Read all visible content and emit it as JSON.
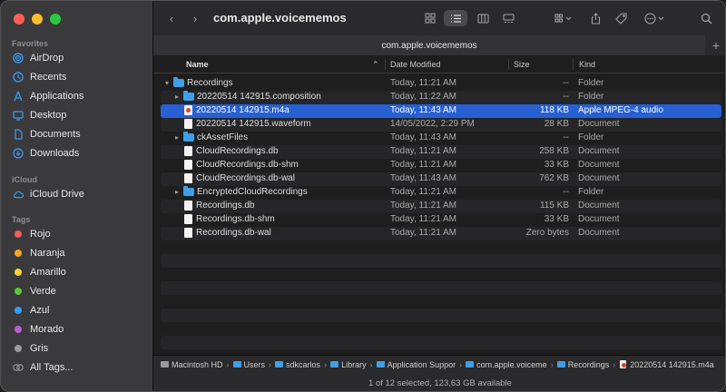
{
  "window": {
    "title": "com.apple.voicememos",
    "tab_label": "com.apple.voicememos"
  },
  "sidebar": {
    "favorites_label": "Favorites",
    "favorites": [
      {
        "label": "AirDrop",
        "icon": "airdrop-icon"
      },
      {
        "label": "Recents",
        "icon": "clock-icon"
      },
      {
        "label": "Applications",
        "icon": "applications-icon"
      },
      {
        "label": "Desktop",
        "icon": "desktop-icon"
      },
      {
        "label": "Documents",
        "icon": "document-icon"
      },
      {
        "label": "Downloads",
        "icon": "download-icon"
      }
    ],
    "icloud_label": "iCloud",
    "icloud": [
      {
        "label": "iCloud Drive",
        "icon": "cloud-icon"
      }
    ],
    "tags_label": "Tags",
    "tags": [
      {
        "label": "Rojo",
        "color": "#ee5f5b"
      },
      {
        "label": "Naranja",
        "color": "#f5a623"
      },
      {
        "label": "Amarillo",
        "color": "#f8d13b"
      },
      {
        "label": "Verde",
        "color": "#5ec63b"
      },
      {
        "label": "Azul",
        "color": "#3b9cf7"
      },
      {
        "label": "Morado",
        "color": "#b95fd4"
      },
      {
        "label": "Gris",
        "color": "#9b9b9b"
      },
      {
        "label": "All Tags...",
        "color": "all"
      }
    ]
  },
  "columns": {
    "name": "Name",
    "date": "Date Modified",
    "size": "Size",
    "kind": "Kind"
  },
  "files": [
    {
      "name": "Recordings",
      "date": "Today, 11:21 AM",
      "size": "--",
      "kind": "Folder",
      "type": "folder",
      "depth": 0,
      "expanded": true,
      "selected": false
    },
    {
      "name": "20220514 142915.composition",
      "date": "Today, 11:22 AM",
      "size": "--",
      "kind": "Folder",
      "type": "folder",
      "depth": 1,
      "expanded": false,
      "selected": false
    },
    {
      "name": "20220514 142915.m4a",
      "date": "Today, 11:43 AM",
      "size": "118 KB",
      "kind": "Apple MPEG-4 audio",
      "type": "m4a",
      "depth": 1,
      "selected": true
    },
    {
      "name": "20220514 142915.waveform",
      "date": "14/05/2022, 2:29 PM",
      "size": "28 KB",
      "kind": "Document",
      "type": "doc",
      "depth": 1,
      "selected": false
    },
    {
      "name": "ckAssetFiles",
      "date": "Today, 11:43 AM",
      "size": "--",
      "kind": "Folder",
      "type": "folder",
      "depth": 1,
      "expanded": false,
      "selected": false
    },
    {
      "name": "CloudRecordings.db",
      "date": "Today, 11:21 AM",
      "size": "258 KB",
      "kind": "Document",
      "type": "doc",
      "depth": 1,
      "selected": false
    },
    {
      "name": "CloudRecordings.db-shm",
      "date": "Today, 11:21 AM",
      "size": "33 KB",
      "kind": "Document",
      "type": "doc",
      "depth": 1,
      "selected": false
    },
    {
      "name": "CloudRecordings.db-wal",
      "date": "Today, 11:43 AM",
      "size": "762 KB",
      "kind": "Document",
      "type": "doc",
      "depth": 1,
      "selected": false
    },
    {
      "name": "EncryptedCloudRecordings",
      "date": "Today, 11:21 AM",
      "size": "--",
      "kind": "Folder",
      "type": "folder",
      "depth": 1,
      "expanded": false,
      "selected": false
    },
    {
      "name": "Recordings.db",
      "date": "Today, 11:21 AM",
      "size": "115 KB",
      "kind": "Document",
      "type": "doc",
      "depth": 1,
      "selected": false
    },
    {
      "name": "Recordings.db-shm",
      "date": "Today, 11:21 AM",
      "size": "33 KB",
      "kind": "Document",
      "type": "doc",
      "depth": 1,
      "selected": false
    },
    {
      "name": "Recordings.db-wal",
      "date": "Today, 11:21 AM",
      "size": "Zero bytes",
      "kind": "Document",
      "type": "doc",
      "depth": 1,
      "selected": false
    }
  ],
  "pathbar": [
    {
      "label": "Macintosh HD",
      "icon": "disk"
    },
    {
      "label": "Users",
      "icon": "folder"
    },
    {
      "label": "sdkcarlos",
      "icon": "folder"
    },
    {
      "label": "Library",
      "icon": "folder"
    },
    {
      "label": "Application Suppor",
      "icon": "folder"
    },
    {
      "label": "com.apple.voiceme",
      "icon": "folder"
    },
    {
      "label": "Recordings",
      "icon": "folder"
    },
    {
      "label": "20220514 142915.m4a",
      "icon": "m4a"
    }
  ],
  "status": "1 of 12 selected, 123,63 GB available"
}
